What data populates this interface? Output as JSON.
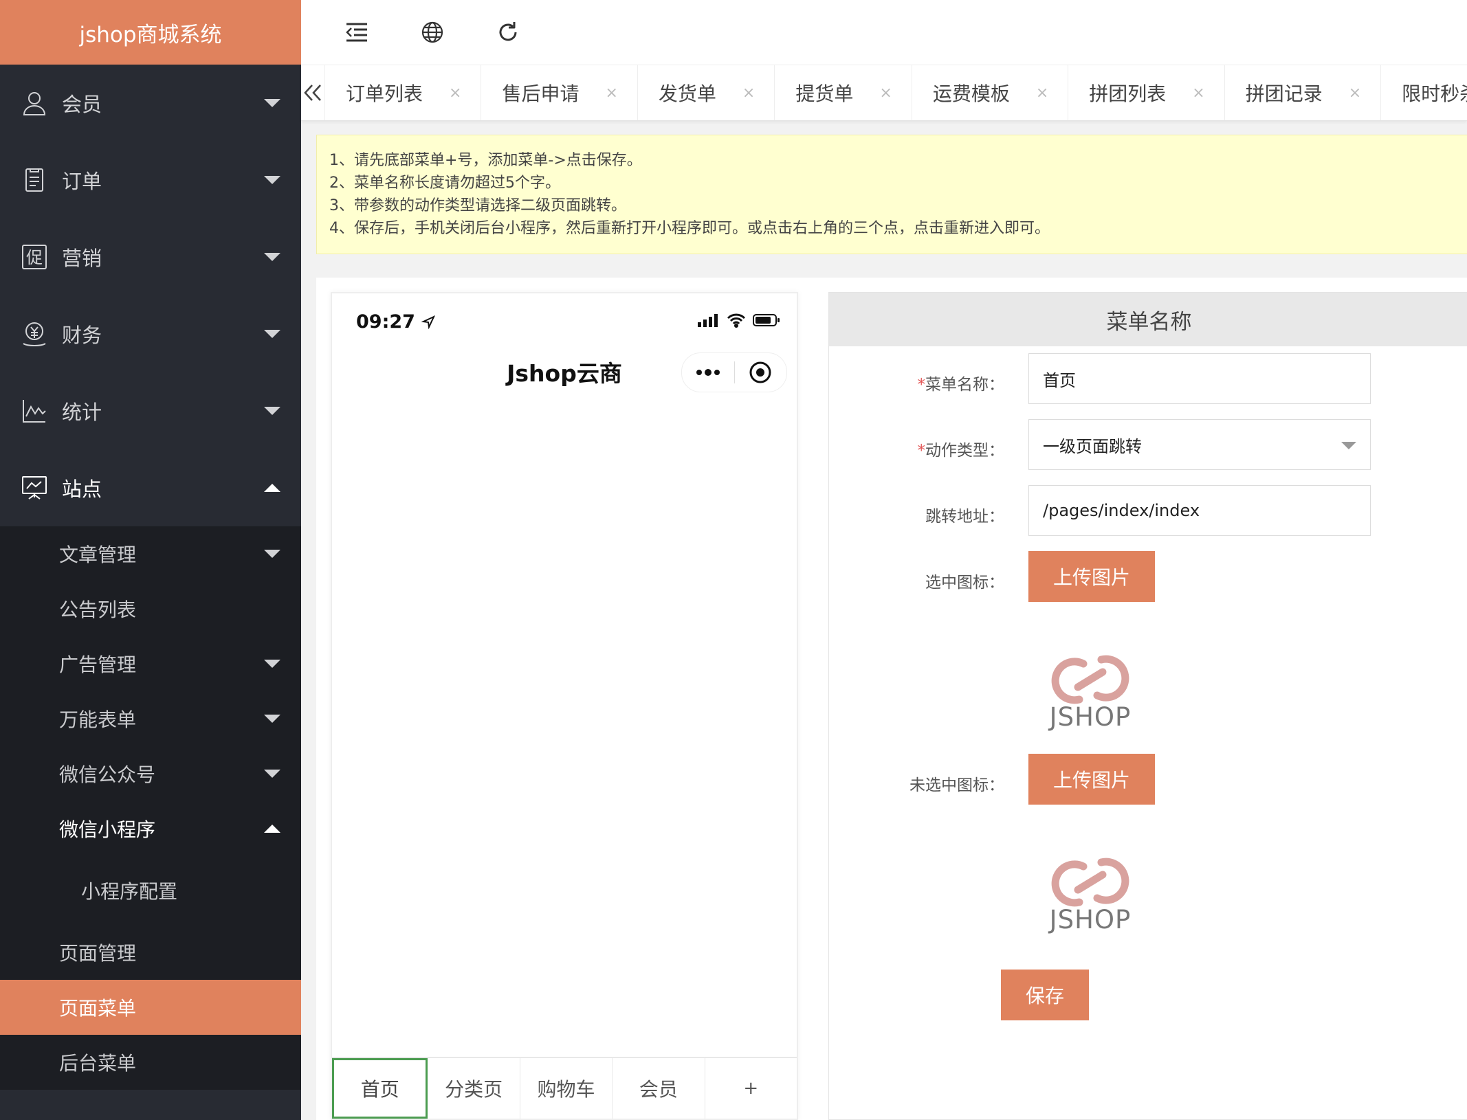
{
  "app": {
    "title": "jshop商城系统"
  },
  "colors": {
    "accent": "#e0825d",
    "sidebar_bg": "#282b33",
    "submenu_bg": "#1c1e23",
    "notice_bg": "#ffffd0"
  },
  "sidebar": {
    "items": [
      {
        "label": "会员",
        "icon": "user-icon"
      },
      {
        "label": "订单",
        "icon": "order-icon"
      },
      {
        "label": "营销",
        "icon": "promotion-icon",
        "glyph": "促"
      },
      {
        "label": "财务",
        "icon": "finance-icon"
      },
      {
        "label": "统计",
        "icon": "chart-icon"
      },
      {
        "label": "站点",
        "icon": "site-icon"
      }
    ],
    "sub": {
      "articles": "文章管理",
      "notices": "公告列表",
      "ads": "广告管理",
      "forms": "万能表单",
      "wechat_official": "微信公众号",
      "wechat_mini": "微信小程序",
      "mini_config": "小程序配置",
      "pages": "页面管理",
      "page_menu": "页面菜单",
      "admin_menu": "后台菜单"
    }
  },
  "toolbar": {
    "icons": [
      "menu-toggle-icon",
      "globe-icon",
      "refresh-icon"
    ]
  },
  "tabs": [
    {
      "label": "订单列表"
    },
    {
      "label": "售后申请"
    },
    {
      "label": "发货单"
    },
    {
      "label": "提货单"
    },
    {
      "label": "运费模板"
    },
    {
      "label": "拼团列表"
    },
    {
      "label": "拼团记录"
    },
    {
      "label": "限时秒杀"
    }
  ],
  "tab_close": "×",
  "notice": {
    "lines": [
      "1、请先底部菜单+号，添加菜单->点击保存。",
      "2、菜单名称长度请勿超过5个字。",
      "3、带参数的动作类型请选择二级页面跳转。",
      "4、保存后，手机关闭后台小程序，然后重新打开小程序即可。或点击右上角的三个点，点击重新进入即可。"
    ]
  },
  "phone": {
    "time": "09:27",
    "title": "Jshop云商",
    "tabs": [
      "首页",
      "分类页",
      "购物车",
      "会员",
      "+"
    ]
  },
  "form": {
    "header": "菜单名称",
    "required_mark": "*",
    "name_label": "菜单名称：",
    "name_value": "首页",
    "action_label": "动作类型：",
    "action_value": "一级页面跳转",
    "url_label": "跳转地址：",
    "url_value": "/pages/index/index",
    "selected_icon_label": "选中图标：",
    "unselected_icon_label": "未选中图标：",
    "upload_label": "上传图片",
    "brand_text": "JSHOP",
    "save_label": "保存"
  }
}
